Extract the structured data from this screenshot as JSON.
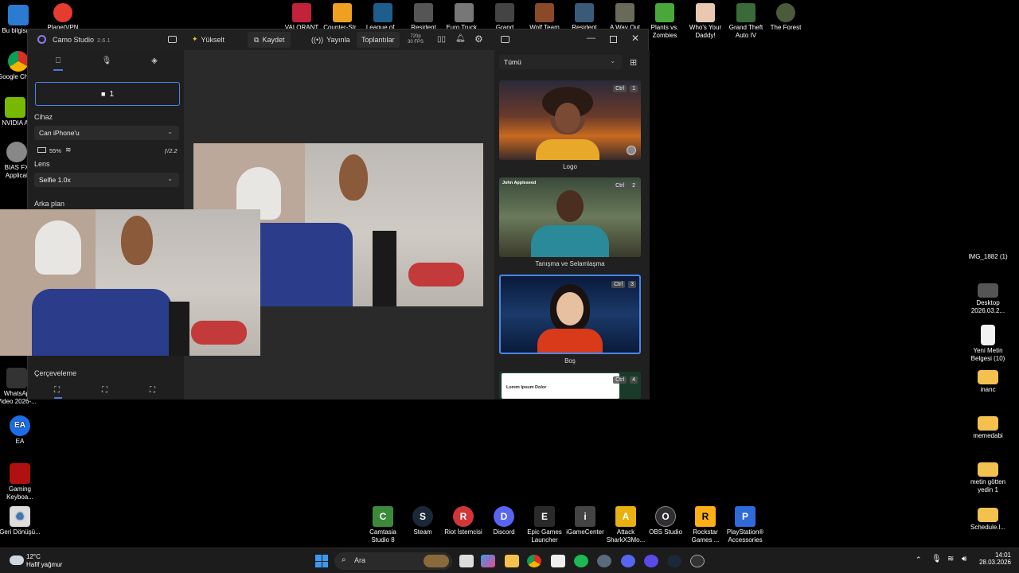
{
  "colors": {
    "accent": "#4a7bd8",
    "window_bg": "#202020",
    "selected_scene_border": "#4a86e8"
  },
  "desktop": {
    "left_icons": [
      {
        "label": "Bu bilgisa...",
        "icon": "computer-icon",
        "color": "#2b7bd3"
      },
      {
        "label": "Google Chrom",
        "icon": "chrome-icon",
        "color": "#d93025"
      },
      {
        "label": "NVIDIA A",
        "icon": "nvidia-icon",
        "color": "#76b900"
      },
      {
        "label": "BIAS FX Applicat",
        "icon": "bias-fx-icon",
        "color": "#888888"
      },
      {
        "label": "WhatsAp Video 2026-...",
        "icon": "video-file-icon",
        "color": "#333333"
      },
      {
        "label": "EA",
        "icon": "ea-icon",
        "color": "#1b6ee8"
      },
      {
        "label": "Gaming Keyboa...",
        "icon": "keyboard-icon",
        "color": "#b01010"
      },
      {
        "label": "Geri Dönüşü...",
        "icon": "recycle-bin-icon",
        "color": "#dddddd"
      }
    ],
    "top_icons": [
      {
        "label": "Bu bilgisa...",
        "color": "#2b7bd3"
      },
      {
        "label": "PlanetVPN",
        "color": "#e63b2e"
      },
      {
        "label": "VALORANT",
        "color": "#c3223b"
      },
      {
        "label": "Counter-Str...",
        "color": "#f0a020"
      },
      {
        "label": "League of...",
        "color": "#1e5e8c"
      },
      {
        "label": "Resident Evil...",
        "color": "#555555"
      },
      {
        "label": "Euro Truck...",
        "color": "#777777"
      },
      {
        "label": "Grand Theft...",
        "color": "#444444"
      },
      {
        "label": "Wolf Team",
        "color": "#8a4a2a"
      },
      {
        "label": "Resident Evil...",
        "color": "#3a5a7a"
      },
      {
        "label": "A Way Out",
        "color": "#6a6a5a"
      },
      {
        "label": "Plants vs. Zombies",
        "color": "#4aa83a"
      },
      {
        "label": "Who's Your Daddy!",
        "color": "#e8c8b0"
      },
      {
        "label": "Grand Theft Auto IV",
        "color": "#3a6a3a"
      },
      {
        "label": "The Forest",
        "color": "#4a5a3a"
      }
    ],
    "right_icons": [
      {
        "label": "IMG_1882 (1)",
        "icon": "image-file-icon",
        "color": "#000000"
      },
      {
        "label": "Desktop 2026.03.2...",
        "icon": "video-file-icon",
        "color": "#555555"
      },
      {
        "label": "Yeni Metin Belgesi (10)",
        "icon": "text-file-icon",
        "color": "#f2f2f2"
      },
      {
        "label": "inanc",
        "icon": "folder-icon",
        "color": "#f2c14e"
      },
      {
        "label": "memedabi",
        "icon": "folder-icon",
        "color": "#f2c14e"
      },
      {
        "label": "metin götten yedin 1",
        "icon": "folder-icon",
        "color": "#f2c14e"
      },
      {
        "label": "Schedule.l...",
        "icon": "folder-icon",
        "color": "#f2c14e"
      }
    ],
    "bottom_icons": [
      {
        "label": "Camtasia Studio 8",
        "color": "#3a8a3a",
        "glyph": "C"
      },
      {
        "label": "Steam",
        "color": "#1b2838",
        "glyph": "S"
      },
      {
        "label": "Riot İstemcisi",
        "color": "#d13639",
        "glyph": "R"
      },
      {
        "label": "Discord",
        "color": "#5865f2",
        "glyph": "D"
      },
      {
        "label": "Epic Games Launcher",
        "color": "#2a2a2a",
        "glyph": "E"
      },
      {
        "label": "iGameCenter",
        "color": "#444444",
        "glyph": "i"
      },
      {
        "label": "Attack SharkX3Mo...",
        "color": "#e8b010",
        "glyph": "A"
      },
      {
        "label": "OBS Studio",
        "color": "#302e31",
        "glyph": "O"
      },
      {
        "label": "Rockstar Games ...",
        "color": "#fcaf17",
        "glyph": "R"
      },
      {
        "label": "PlayStation® Accessories",
        "color": "#2f6ad9",
        "glyph": "P"
      }
    ]
  },
  "app": {
    "title": "Camo Studio",
    "version": "2.6.1",
    "upgrade_label": "Yükselt",
    "record_label": "Kaydet",
    "stream_label": "Yayınla",
    "meetings_label": "Toplantılar",
    "resolution": "720p",
    "fps": "30 FPS",
    "sidebar": {
      "camera_selector": "1",
      "device_label": "Cihaz",
      "device_value": "Can iPhone'u",
      "battery": "55%",
      "aperture": "ƒ/2.2",
      "lens_label": "Lens",
      "lens_value": "Selfie 1.0x",
      "background_label": "Arka plan",
      "framing_label": "Çerçeveleme"
    },
    "scenes": {
      "filter": "Tümü",
      "items": [
        {
          "label": "Logo",
          "ctrl": "Ctrl",
          "num": "1"
        },
        {
          "label": "Tanışma ve Selamlaşma",
          "ctrl": "Ctrl",
          "num": "2",
          "overlay_name": "John Appleseed"
        },
        {
          "label": "Boş",
          "ctrl": "Ctrl",
          "num": "3"
        },
        {
          "label": "",
          "ctrl": "Ctrl",
          "num": "4",
          "overlay_text": "Lorem Ipsum Dolor"
        }
      ]
    }
  },
  "taskbar": {
    "weather_temp": "12°C",
    "weather_desc": "Hafif yağmur",
    "search_placeholder": "Ara",
    "time": "14:01",
    "date": "28.03.2026"
  }
}
